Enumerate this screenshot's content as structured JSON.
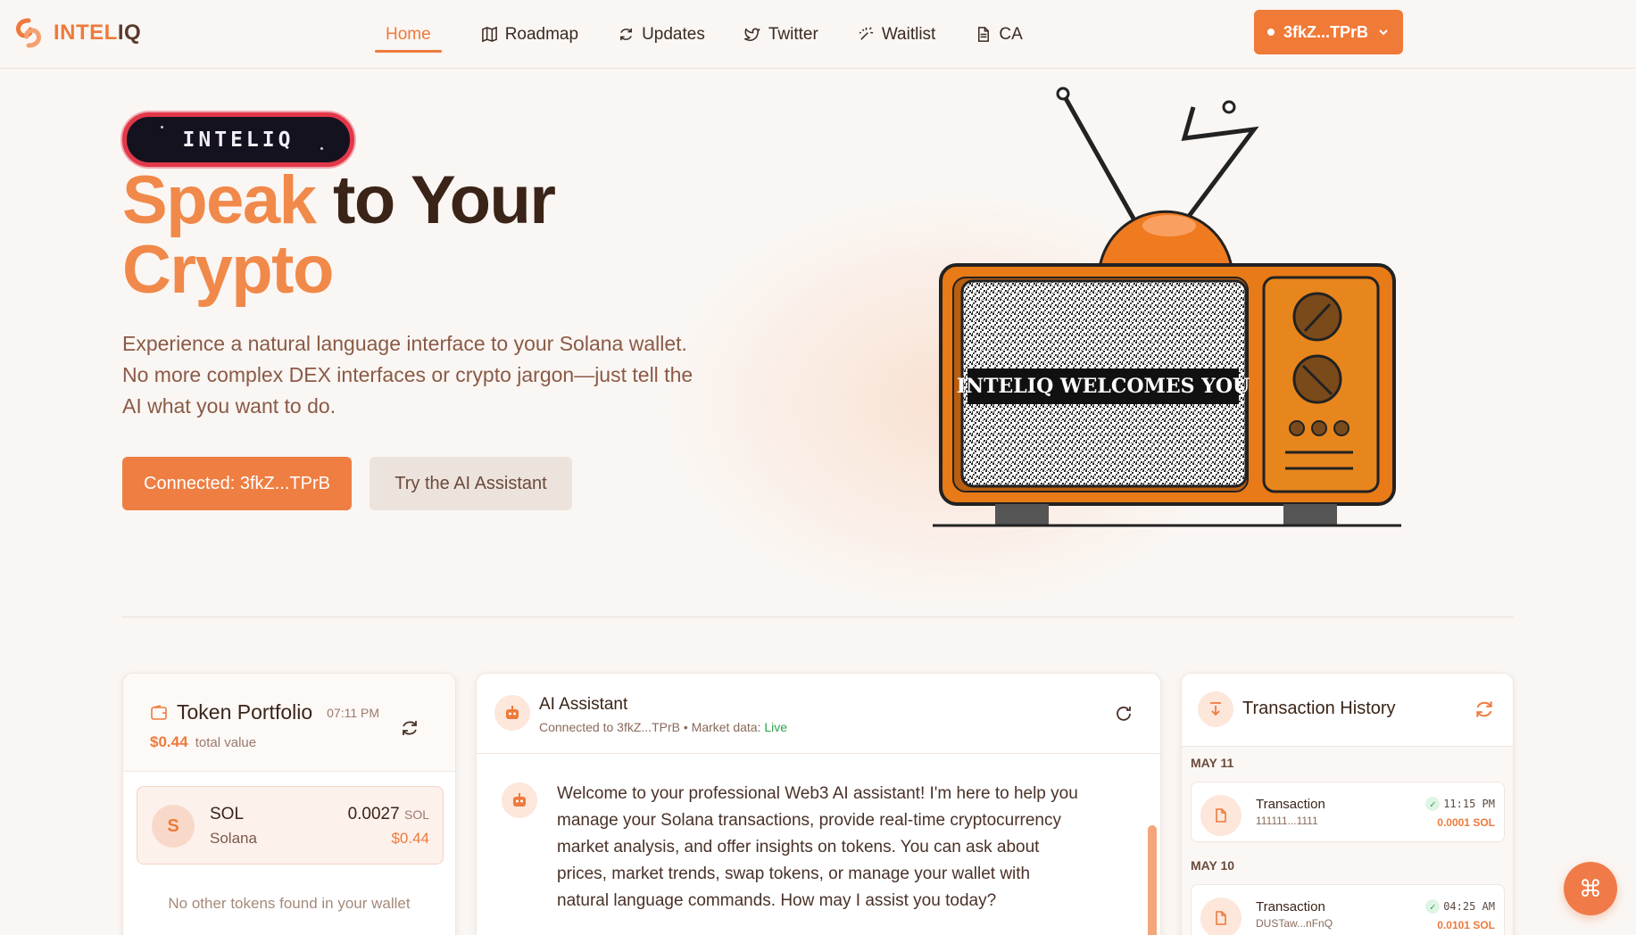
{
  "brand": {
    "name_part1": "INTEL",
    "name_part2": "IQ"
  },
  "nav": {
    "items": [
      {
        "label": "Home",
        "icon": "none",
        "active": true
      },
      {
        "label": "Roadmap",
        "icon": "map-icon"
      },
      {
        "label": "Updates",
        "icon": "refresh-icon"
      },
      {
        "label": "Twitter",
        "icon": "twitter-icon"
      },
      {
        "label": "Waitlist",
        "icon": "sparkles-icon"
      },
      {
        "label": "CA",
        "icon": "document-icon"
      }
    ],
    "wallet_label": "3fkZ...TPrB"
  },
  "hero": {
    "badge": "INTELIQ",
    "headline_accent1": "Speak",
    "headline_dark": " to Your",
    "headline_accent2": "Crypto",
    "subtitle": "Experience a natural language interface to your Solana wallet. No more complex DEX interfaces or crypto jargon—just tell the AI what you want to do.",
    "primary_button": "Connected: 3fkZ...TPrB",
    "secondary_button": "Try the AI Assistant",
    "tv_screen_text": "INTELIQ WELCOMES YOU"
  },
  "portfolio": {
    "title": "Token Portfolio",
    "time": "07:11 PM",
    "total_value": "$0.44",
    "total_label": "total value",
    "tokens": [
      {
        "avatar": "S",
        "symbol": "SOL",
        "name": "Solana",
        "amount": "0.0027",
        "unit": "SOL",
        "usd": "$0.44"
      }
    ],
    "empty_message": "No other tokens found in your wallet"
  },
  "assistant": {
    "title": "AI Assistant",
    "connected_text": "Connected to 3fkZ...TPrB",
    "market_label": "• Market data:",
    "market_status": "Live",
    "welcome_message": "Welcome to your professional Web3 AI assistant! I'm here to help you manage your Solana transactions, provide real-time cryptocurrency market analysis, and offer insights on tokens. You can ask about prices, market trends, swap tokens, or manage your wallet with natural language commands. How may I assist you today?"
  },
  "history": {
    "title": "Transaction History",
    "groups": [
      {
        "date": "MAY 11",
        "tx": {
          "label": "Transaction",
          "address": "111111...1111",
          "time": "11:15 PM",
          "amount": "0.0001 SOL"
        }
      },
      {
        "date": "MAY 10",
        "tx": {
          "label": "Transaction",
          "address": "DUSTaw...nFnQ",
          "time": "04:25 AM",
          "amount": "0.0101 SOL"
        }
      }
    ]
  },
  "fab_icon": "command-icon",
  "colors": {
    "accent": "#ee7a3c",
    "background": "#faf6f3",
    "dark_text": "#3a2418",
    "badge_border": "#e2384a"
  }
}
